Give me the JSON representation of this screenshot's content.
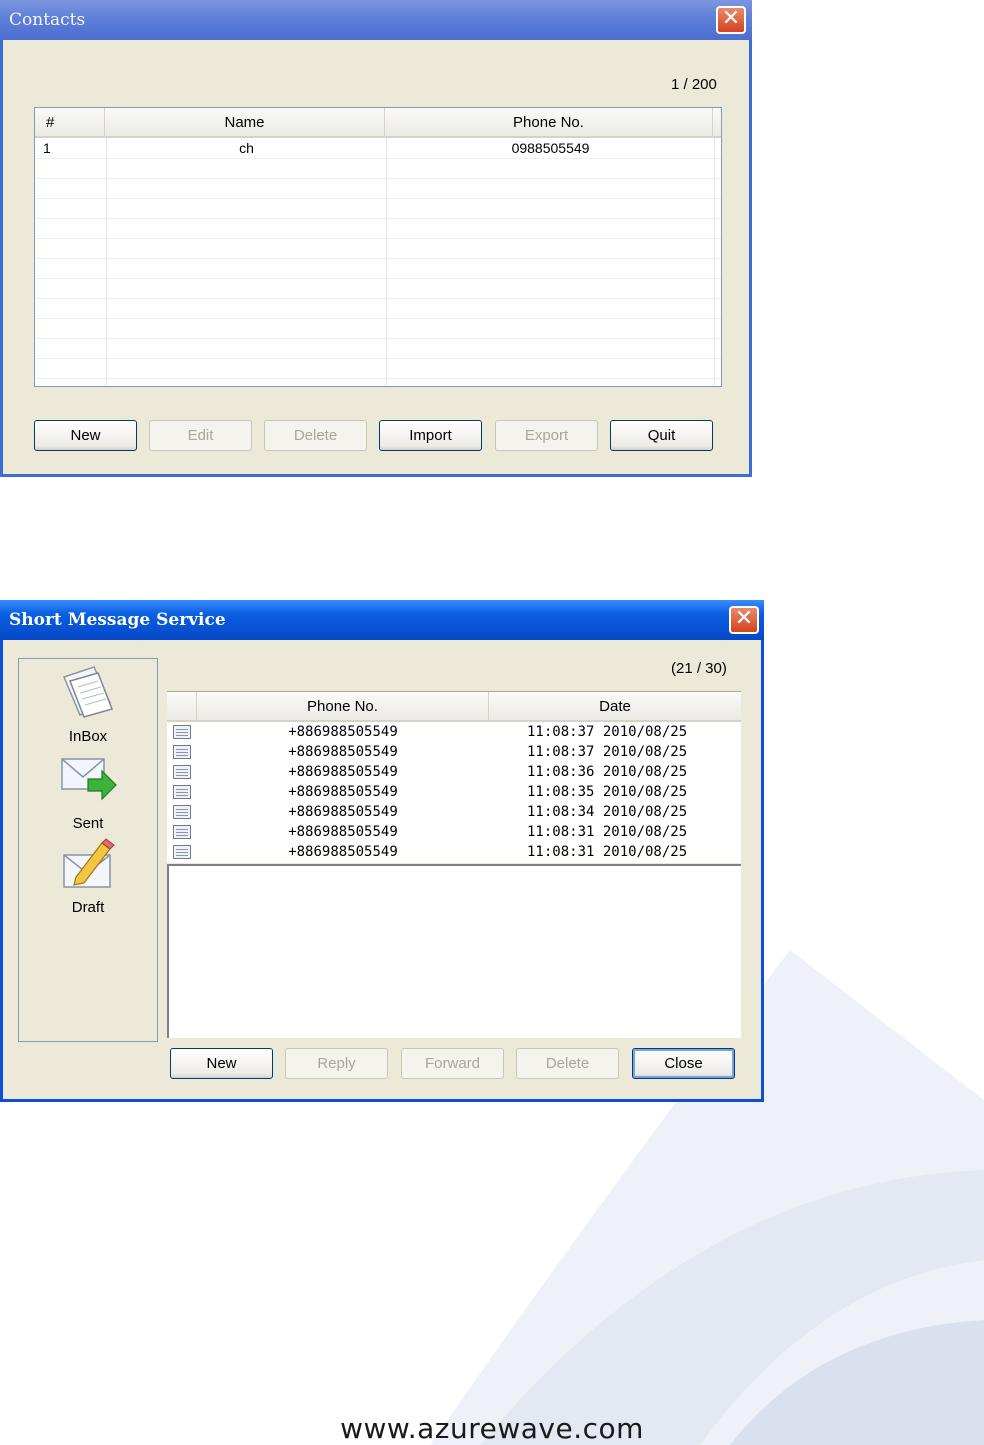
{
  "colors": {
    "title_contacts": "#6b88dc",
    "title_sms": "#0a5fe0",
    "dialog_bg": "#ece9d8",
    "close_red": "#d2421e"
  },
  "contacts": {
    "title": "Contacts",
    "counter": "1 / 200",
    "columns": [
      "#",
      "Name",
      "Phone No."
    ],
    "rows": [
      {
        "num": "1",
        "name": "ch",
        "phone": "0988505549"
      }
    ],
    "buttons": {
      "new": "New",
      "edit": "Edit",
      "delete": "Delete",
      "import": "Import",
      "export": "Export",
      "quit": "Quit"
    }
  },
  "sms": {
    "title": "Short Message Service",
    "counter": "(21 / 30)",
    "nav": {
      "inbox": "InBox",
      "sent": "Sent",
      "draft": "Draft"
    },
    "columns": [
      "Phone No.",
      "Date"
    ],
    "messages": [
      {
        "phone": "+886988505549",
        "date": "11:08:37 2010/08/25"
      },
      {
        "phone": "+886988505549",
        "date": "11:08:37 2010/08/25"
      },
      {
        "phone": "+886988505549",
        "date": "11:08:36 2010/08/25"
      },
      {
        "phone": "+886988505549",
        "date": "11:08:35 2010/08/25"
      },
      {
        "phone": "+886988505549",
        "date": "11:08:34 2010/08/25"
      },
      {
        "phone": "+886988505549",
        "date": "11:08:31 2010/08/25"
      },
      {
        "phone": "+886988505549",
        "date": "11:08:31 2010/08/25"
      }
    ],
    "buttons": {
      "new": "New",
      "reply": "Reply",
      "forward": "Forward",
      "delete": "Delete",
      "close": "Close"
    }
  },
  "footer": "www.azurewave.com"
}
